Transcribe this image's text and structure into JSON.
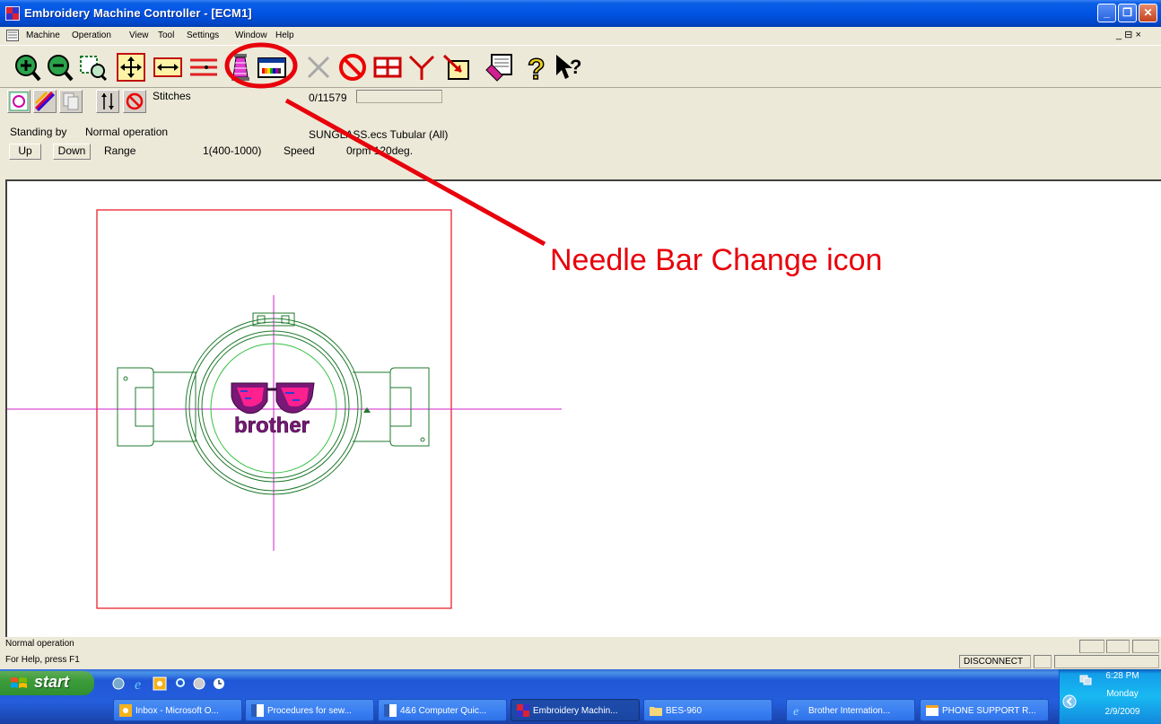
{
  "window": {
    "title": "Embroidery Machine Controller - [ECM1]"
  },
  "menubar": {
    "items": [
      "Machine",
      "Operation",
      "View",
      "Tool",
      "Settings",
      "Window",
      "Help"
    ],
    "mdi_controls": "_ ⊟ ×"
  },
  "toolbar": {
    "buttons": [
      "zoom-in-icon",
      "zoom-out-icon",
      "zoom-window-icon",
      "fit-all-icon",
      "fit-width-icon",
      "stitch-lines-icon",
      "thread-spool-icon",
      "needle-bar-change-icon",
      "cancel-x-icon",
      "stop-icon",
      "grid-icon",
      "trim-icon",
      "frame-move-icon",
      "pattern-icon",
      "help-icon",
      "context-help-icon"
    ]
  },
  "status_panel": {
    "stitches_label": "Stitches",
    "stitches_value": "0/11579",
    "state": "Standing by",
    "operation": "Normal operation",
    "file": "SUNGLASS.ecs Tubular (All)",
    "up_button": "Up",
    "down_button": "Down",
    "range_label": "Range",
    "range_value": "1(400-1000)",
    "speed_label": "Speed",
    "speed_value": "0rpm 120deg."
  },
  "annotation": {
    "label": "Needle Bar Change icon",
    "color": "#e8000b"
  },
  "statusbar": {
    "line1": "Normal operation",
    "line2": "For Help, press F1",
    "connection": "DISCONNECT"
  },
  "taskbar": {
    "start": "start",
    "tasks": [
      {
        "label": "Inbox - Microsoft O...",
        "active": false
      },
      {
        "label": "Procedures for sew...",
        "active": false
      },
      {
        "label": "4&6 Computer Quic...",
        "active": false
      },
      {
        "label": "Embroidery Machin...",
        "active": true
      },
      {
        "label": "BES-960",
        "active": false
      },
      {
        "label": "Brother Internation...",
        "active": false
      },
      {
        "label": "PHONE SUPPORT R...",
        "active": false
      }
    ],
    "time": "6:28 PM",
    "day": "Monday",
    "date": "2/9/2009"
  },
  "design": {
    "text": "brother"
  }
}
